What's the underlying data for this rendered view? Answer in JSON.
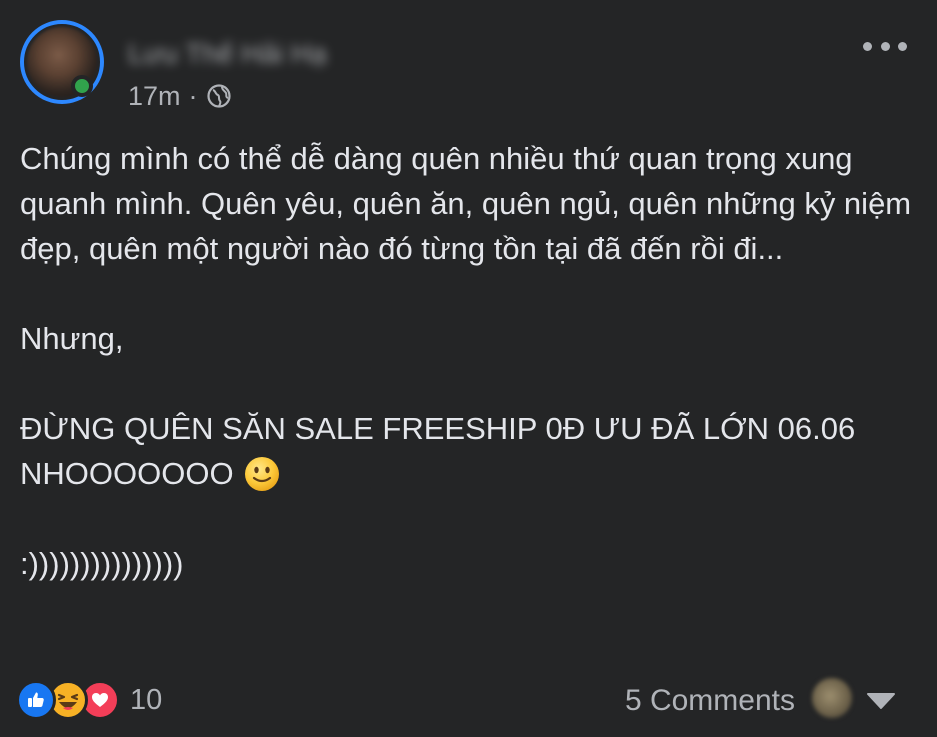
{
  "post": {
    "author_name": "Lưu Thế Hải Hạ",
    "timestamp": "17m",
    "separator": "·",
    "privacy_icon": "globe-icon",
    "more_icon": "more-horizontal-icon",
    "paragraphs": [
      "Chúng mình có thể dễ dàng quên nhiều thứ quan trọng xung quanh mình. Quên yêu, quên ăn, quên ngủ, quên những kỷ niệm đẹp, quên một người nào đó từng tồn tại đã đến rồi đi...",
      "Nhưng,",
      "ĐỪNG QUÊN SĂN SALE FREESHIP 0Đ ƯU ĐÃ LỚN 06.06 NHOOOOOOO",
      ":)))))))))))))))"
    ],
    "emoji": "slightly-smiling-face"
  },
  "footer": {
    "reactions": [
      "like",
      "haha",
      "love"
    ],
    "reaction_count": "10",
    "comments_label": "5 Comments"
  },
  "colors": {
    "background": "#242526",
    "text": "#e4e6eb",
    "secondary_text": "#b0b3b8",
    "story_ring": "#2d88ff",
    "online": "#31a24c",
    "like": "#1877f2",
    "haha": "#f7b125",
    "love": "#f33e58"
  }
}
